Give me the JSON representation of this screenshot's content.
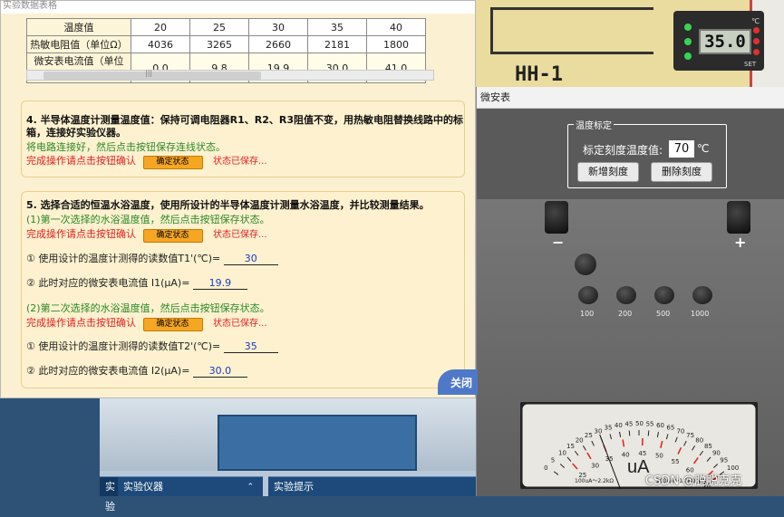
{
  "data_window": {
    "title": "实验数据表格",
    "table": {
      "rows": [
        {
          "header": "温度值",
          "values": [
            "20",
            "25",
            "30",
            "35",
            "40"
          ]
        },
        {
          "header": "热敏电阻值（单位Ω）",
          "values": [
            "4036",
            "3265",
            "2660",
            "2181",
            "1800"
          ]
        },
        {
          "header": "微安表电流值（单位μA）",
          "values": [
            "0.0",
            "9.8",
            "19.9",
            "30.0",
            "41.0"
          ]
        }
      ]
    },
    "scroll_label": "|||",
    "section4": {
      "heading": "4. 半导体温度计测量温度值：保持可调电阻器R1、R2、R3阻值不变，用热敏电阻替换线路中的标准电",
      "heading2": "箱，连接好实验仪器。",
      "instruction": "将电路连接好，然后点击按钮保存连线状态。",
      "prompt": "完成操作请点击按钮确认",
      "button": "确定状态",
      "status": "状态已保存..."
    },
    "section5": {
      "heading": "5. 选择合适的恒温水浴温度，使用所设计的半导体温度计测量水浴温度，并比较测量结果。",
      "first_instruction": "(1)第一次选择的水浴温度值，然后点击按钮保存状态。",
      "prompt": "完成操作请点击按钮确认",
      "button": "确定状态",
      "status": "状态已保存...",
      "q1_label": "① 使用设计的温度计测得的读数值T1'(℃)=",
      "q1_value": "30",
      "q2_label": "② 此时对应的微安表电流值 I1(μA)=",
      "q2_value": "19.9",
      "second_instruction": "(2)第二次选择的水浴温度值，然后点击按钮保存状态。",
      "q3_label": "① 使用设计的温度计测得的读数值T2'(℃)=",
      "q3_value": "35",
      "q4_label": "② 此时对应的微安表电流值 I2(μA)=",
      "q4_value": "30.0"
    },
    "close_button": "关闭"
  },
  "thermostat": {
    "model": "HH-1",
    "display": "35.0",
    "unit": "℃",
    "set_label": "SET"
  },
  "meter_window": {
    "title": "微安表",
    "calibration_group": "温度标定",
    "calibration_label": "标定刻度温度值:",
    "calibration_value": "70",
    "calibration_unit": "℃",
    "add_button": "新增刻度",
    "delete_button": "删除刻度",
    "terminal_minus": "−",
    "terminal_plus": "+",
    "range_labels": [
      "100",
      "200",
      "500",
      "1000"
    ],
    "dial_unit": "uA",
    "scale_numbers": [
      "0",
      "5",
      "10",
      "15",
      "20",
      "25",
      "30",
      "35",
      "40",
      "45",
      "50",
      "55",
      "60",
      "65",
      "70",
      "75",
      "80",
      "85",
      "90",
      "95",
      "100"
    ],
    "temp_marks": [
      "20",
      "25",
      "30",
      "35",
      "40",
      "45",
      "50",
      "55",
      "60",
      "65",
      "70"
    ],
    "spec_1": "100uA～2.2kΩ",
    "spec_2": "200uA～1.1kΩ",
    "spec_3": "500uA～560Ω",
    "spec_4": "1000uA～300Ω",
    "needle_value": 30
  },
  "bottom_bar": {
    "tab1": "实验仪器",
    "tab2": "实验提示",
    "left_fragment": "实验"
  },
  "watermark": "CSDN @脱脱克克"
}
